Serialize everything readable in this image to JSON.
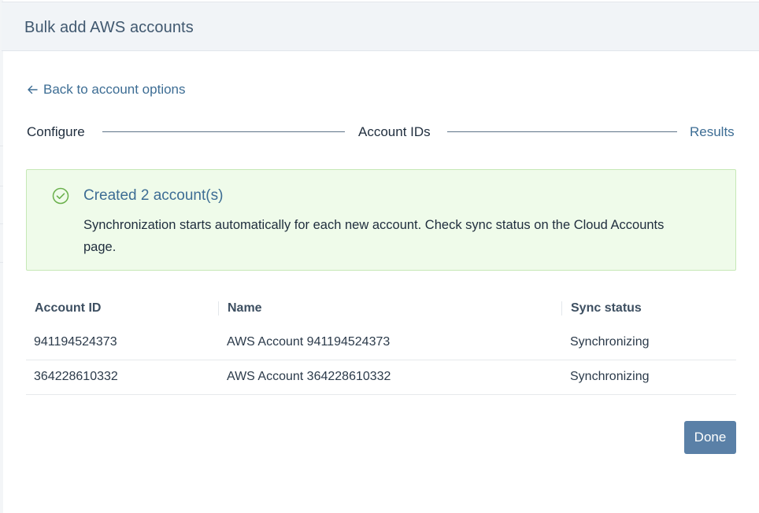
{
  "modal": {
    "title": "Bulk add AWS accounts"
  },
  "back_link": {
    "label": "Back to account options"
  },
  "stepper": {
    "steps": [
      {
        "label": "Configure",
        "state": "complete"
      },
      {
        "label": "Account IDs",
        "state": "complete"
      },
      {
        "label": "Results",
        "state": "active"
      }
    ]
  },
  "alert": {
    "icon": "check-circle-icon",
    "title": "Created 2 account(s)",
    "body": "Synchronization starts automatically for each new account. Check sync status on the Cloud Accounts page.",
    "color": "#6ab04c"
  },
  "table": {
    "columns": [
      "Account ID",
      "Name",
      "Sync status"
    ],
    "rows": [
      {
        "account_id": "941194524373",
        "name": "AWS Account 941194524373",
        "sync_status": "Synchronizing"
      },
      {
        "account_id": "364228610332",
        "name": "AWS Account 364228610332",
        "sync_status": "Synchronizing"
      }
    ]
  },
  "footer": {
    "done_label": "Done"
  },
  "colors": {
    "accent": "#3d6d94",
    "primary_button": "#5a80a7",
    "success_bg": "#effbea",
    "success_border": "#c6e8b6"
  }
}
